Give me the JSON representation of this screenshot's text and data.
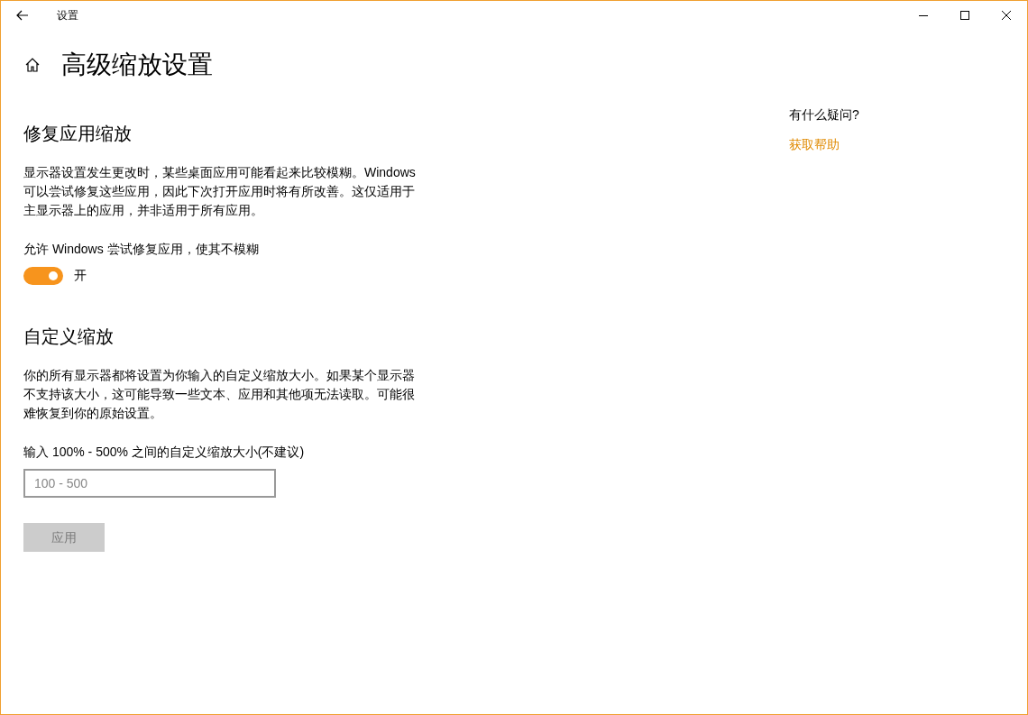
{
  "window": {
    "title": "设置"
  },
  "page": {
    "title": "高级缩放设置"
  },
  "fix_section": {
    "heading": "修复应用缩放",
    "description": "显示器设置发生更改时，某些桌面应用可能看起来比较模糊。Windows 可以尝试修复这些应用，因此下次打开应用时将有所改善。这仅适用于主显示器上的应用，并非适用于所有应用。",
    "toggle_label": "允许 Windows 尝试修复应用，使其不模糊",
    "toggle": {
      "on": true,
      "state_text": "开"
    }
  },
  "custom_section": {
    "heading": "自定义缩放",
    "description": "你的所有显示器都将设置为你输入的自定义缩放大小。如果某个显示器不支持该大小，这可能导致一些文本、应用和其他项无法读取。可能很难恢复到你的原始设置。",
    "field_label": "输入 100% - 500% 之间的自定义缩放大小(不建议)",
    "field": {
      "placeholder": "100 - 500"
    },
    "button": {
      "label": "应用",
      "disabled": true
    }
  },
  "help": {
    "question": "有什么疑问?",
    "link": "获取帮助"
  }
}
